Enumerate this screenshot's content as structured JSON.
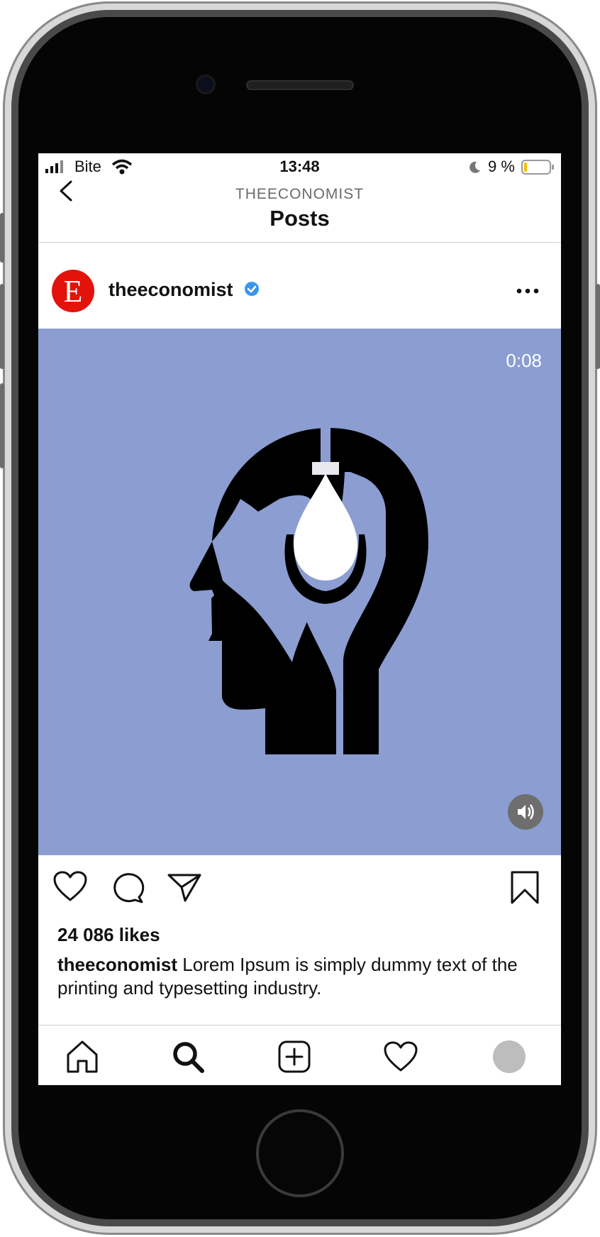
{
  "status_bar": {
    "carrier": "Bite",
    "time": "13:48",
    "battery_percent": "9 %"
  },
  "nav": {
    "subtitle": "THEECONOMIST",
    "title": "Posts"
  },
  "post": {
    "avatar_letter": "E",
    "username": "theeconomist",
    "verified": true,
    "video_time": "0:08",
    "likes": "24 086 likes",
    "caption_user": "theeconomist",
    "caption_text": " Lorem Ipsum is simply dummy text of the printing and typesetting industry."
  },
  "icons": [
    "back-icon",
    "verified-badge-icon",
    "more-options-icon",
    "speaker-icon",
    "heart-icon",
    "comment-icon",
    "share-icon",
    "bookmark-icon",
    "home-icon",
    "search-icon",
    "add-post-icon",
    "activity-heart-icon",
    "profile-icon"
  ],
  "colors": {
    "media_background": "#8b9dd1",
    "brand_red": "#e3120b",
    "verified_blue": "#3897f0"
  }
}
